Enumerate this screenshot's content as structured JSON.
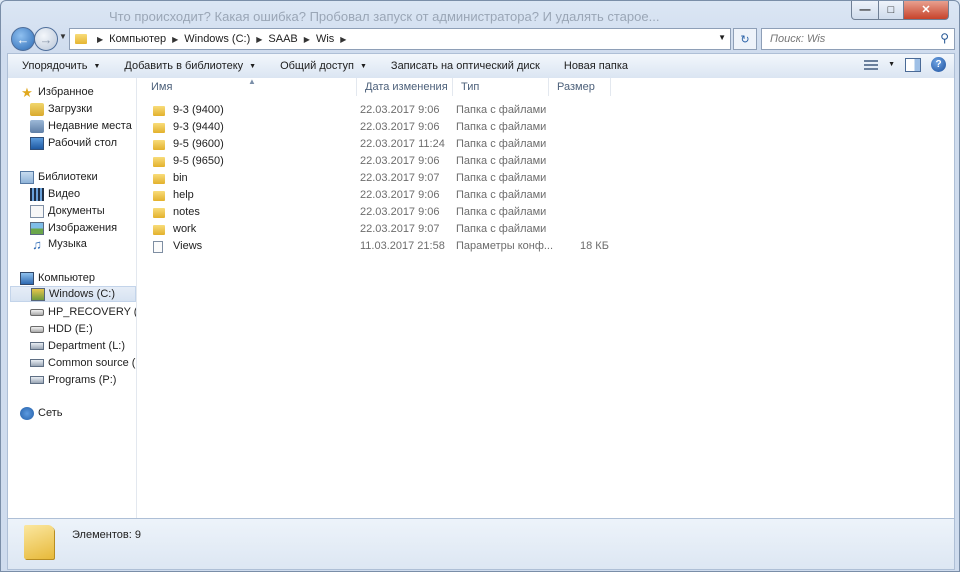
{
  "window": {
    "behind_text": "Что происходит? Какая ошибка? Пробовал запуск от администратора? И удалять старое..."
  },
  "address": {
    "crumbs": [
      "Компьютер",
      "Windows  (C:)",
      "SAAB",
      "Wis"
    ]
  },
  "search": {
    "placeholder": "Поиск: Wis"
  },
  "toolbar": {
    "organize": "Упорядочить",
    "add_to_library": "Добавить в библиотеку",
    "share": "Общий доступ",
    "burn": "Записать на оптический диск",
    "new_folder": "Новая папка"
  },
  "sidebar": {
    "favorites": "Избранное",
    "downloads": "Загрузки",
    "recent": "Недавние места",
    "desktop": "Рабочий стол",
    "libraries": "Библиотеки",
    "video": "Видео",
    "documents": "Документы",
    "images": "Изображения",
    "music": "Музыка",
    "computer": "Компьютер",
    "drive_c": "Windows  (C:)",
    "drive_d": "HP_RECOVERY (D:)",
    "drive_e": "HDD (E:)",
    "drive_l": "Department (L:)",
    "drive_m": "Common source (M",
    "drive_p": "Programs (P:)",
    "network": "Сеть"
  },
  "columns": {
    "name": "Имя",
    "date": "Дата изменения",
    "type": "Тип",
    "size": "Размер"
  },
  "files": [
    {
      "name": "9-3 (9400)",
      "date": "22.03.2017 9:06",
      "type": "Папка с файлами",
      "size": "",
      "kind": "folder"
    },
    {
      "name": "9-3 (9440)",
      "date": "22.03.2017 9:06",
      "type": "Папка с файлами",
      "size": "",
      "kind": "folder"
    },
    {
      "name": "9-5 (9600)",
      "date": "22.03.2017 11:24",
      "type": "Папка с файлами",
      "size": "",
      "kind": "folder"
    },
    {
      "name": "9-5 (9650)",
      "date": "22.03.2017 9:06",
      "type": "Папка с файлами",
      "size": "",
      "kind": "folder"
    },
    {
      "name": "bin",
      "date": "22.03.2017 9:07",
      "type": "Папка с файлами",
      "size": "",
      "kind": "folder"
    },
    {
      "name": "help",
      "date": "22.03.2017 9:06",
      "type": "Папка с файлами",
      "size": "",
      "kind": "folder"
    },
    {
      "name": "notes",
      "date": "22.03.2017 9:06",
      "type": "Папка с файлами",
      "size": "",
      "kind": "folder"
    },
    {
      "name": "work",
      "date": "22.03.2017 9:07",
      "type": "Папка с файлами",
      "size": "",
      "kind": "folder"
    },
    {
      "name": "Views",
      "date": "11.03.2017 21:58",
      "type": "Параметры конф...",
      "size": "18 КБ",
      "kind": "file"
    }
  ],
  "status": {
    "items_count": "Элементов: 9"
  }
}
